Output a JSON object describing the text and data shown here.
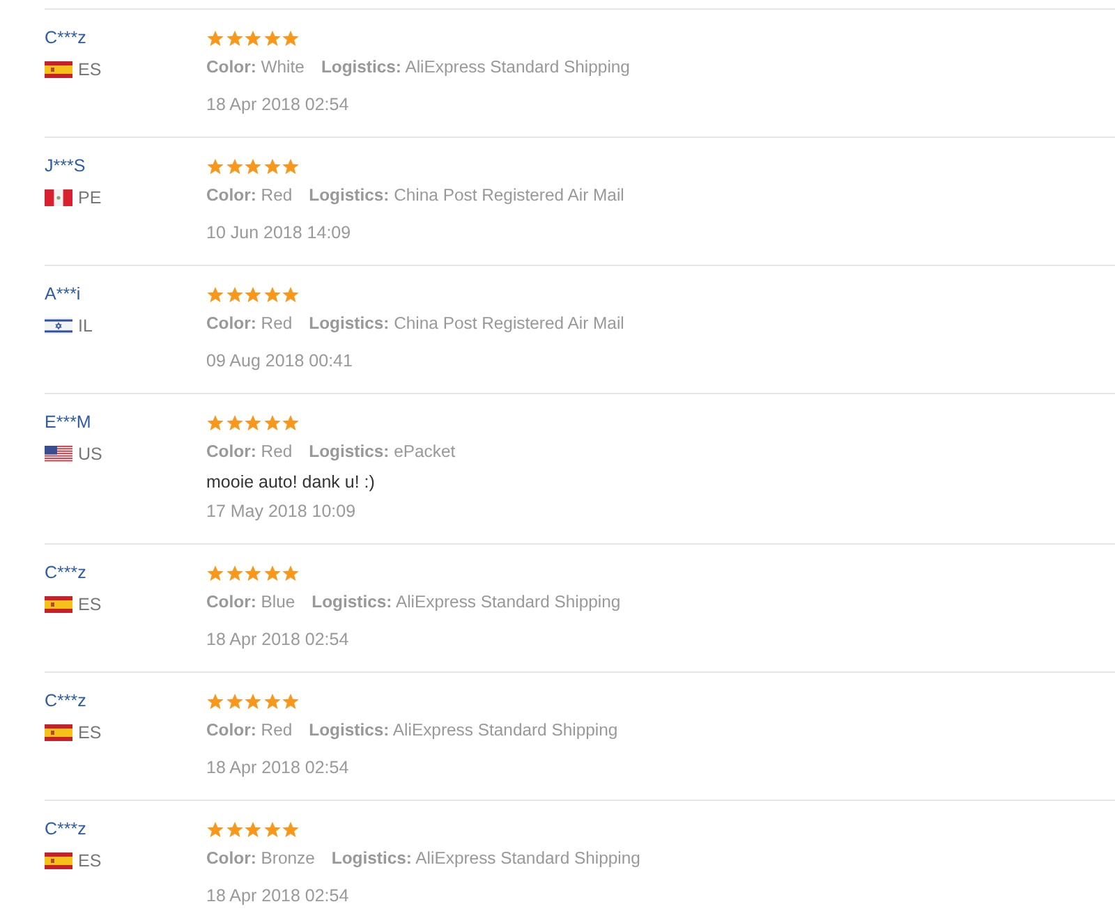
{
  "reviews": [
    {
      "name": "C***z",
      "flag": {
        "kind": "spain"
      },
      "country": "ES",
      "stars": 5,
      "attributes": [
        {
          "text": "**Color:** White"
        },
        {
          "text": "**Logistics:** AliExpress Standard Shipping"
        }
      ],
      "date": "18 Apr 2018 02:54"
    },
    {
      "name": "J***S",
      "flag": {
        "kind": "peru"
      },
      "country": "PE",
      "stars": 5,
      "attributes": [
        {
          "text": "**Color:** Red"
        },
        {
          "text": "**Logistics:** China Post Registered Air Mail"
        }
      ],
      "date": "10 Jun 2018 14:09"
    },
    {
      "name": "A***i",
      "flag": {
        "kind": "israel"
      },
      "country": "IL",
      "stars": 5,
      "attributes": [
        {
          "text": "**Color:** Red"
        },
        {
          "text": "**Logistics:** China Post Registered Air Mail"
        }
      ],
      "date": "09 Aug 2018 00:41"
    },
    {
      "name": "E***M",
      "flag": {
        "kind": "usa"
      },
      "country": "US",
      "stars": 5,
      "attributes": [
        {
          "text": "**Color:** Red"
        },
        {
          "text": "**Logistics:** ePacket"
        }
      ],
      "comment": "mooie auto! dank u! :)",
      "date": "17 May 2018 10:09"
    },
    {
      "name": "C***z",
      "flag": {
        "kind": "spain"
      },
      "country": "ES",
      "stars": 5,
      "attributes": [
        {
          "text": "**Color:** Blue"
        },
        {
          "text": "**Logistics:** AliExpress Standard Shipping"
        }
      ],
      "date": "18 Apr 2018 02:54"
    },
    {
      "name": "C***z",
      "flag": {
        "kind": "spain"
      },
      "country": "ES",
      "stars": 5,
      "attributes": [
        {
          "text": "**Color:** Red"
        },
        {
          "text": "**Logistics:** AliExpress Standard Shipping"
        }
      ],
      "date": "18 Apr 2018 02:54"
    },
    {
      "name": "C***z",
      "flag": {
        "kind": "spain"
      },
      "country": "ES",
      "stars": 5,
      "attributes": [
        {
          "text": "**Color:** Bronze"
        },
        {
          "text": "**Logistics:** AliExpress Standard Shipping"
        }
      ],
      "date": "18 Apr 2018 02:54"
    }
  ]
}
